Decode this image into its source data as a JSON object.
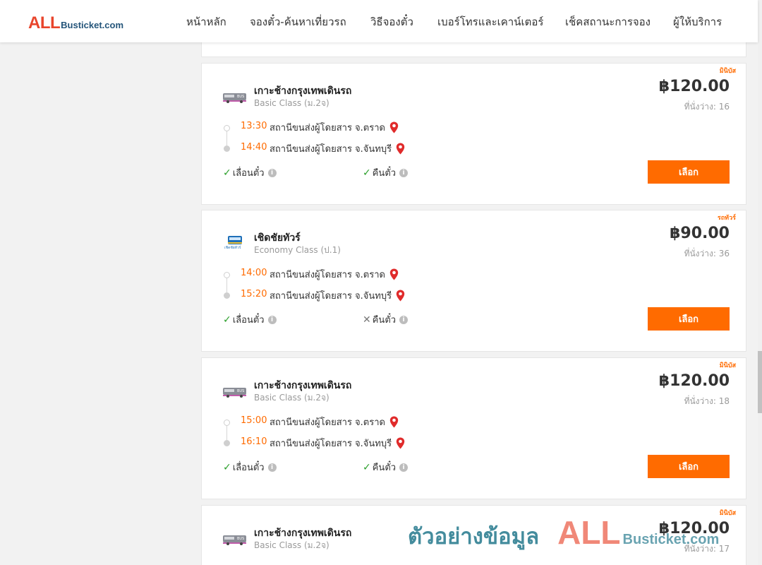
{
  "brand": {
    "logo_all": "ALL",
    "logo_rest": "Busticket.com"
  },
  "nav": {
    "items": [
      {
        "label": "หน้าหลัก"
      },
      {
        "label": "จองตั๋ว-ค้นหาเที่ยวรถ"
      },
      {
        "label": "วิธีจองตั๋ว"
      },
      {
        "label": "เบอร์โทรและเคาน์เตอร์"
      },
      {
        "label": "เช็คสถานะการจอง"
      },
      {
        "label": "ผู้ให้บริการ"
      }
    ]
  },
  "trips": [
    {
      "type_tag": "มินิบัส",
      "operator": "เกาะช้างกรุงเทพเดินรถ",
      "class": "Basic Class (ม.2จ)",
      "price": "฿120.00",
      "seats": "ที่นั่งว่าง: 16",
      "depart_time": "13:30",
      "depart_station": "สถานีขนส่งผู้โดยสาร จ.ตราด",
      "arrive_time": "14:40",
      "arrive_station": "สถานีขนส่งผู้โดยสาร จ.จันทบุรี",
      "option_change": "เลื่อนตั๋ว",
      "option_change_available": true,
      "option_refund": "คืนตั๋ว",
      "option_refund_available": true,
      "select_label": "เลือก",
      "logo_icon": "bus-company-logo-icon"
    },
    {
      "type_tag": "รถทัวร์",
      "operator": "เชิดชัยทัวร์",
      "class": "Economy Class (ป.1)",
      "price": "฿90.00",
      "seats": "ที่นั่งว่าง: 36",
      "depart_time": "14:00",
      "depart_station": "สถานีขนส่งผู้โดยสาร จ.ตราด",
      "arrive_time": "15:20",
      "arrive_station": "สถานีขนส่งผู้โดยสาร จ.จันทบุรี",
      "option_change": "เลื่อนตั๋ว",
      "option_change_available": true,
      "option_refund": "คืนตั๋ว",
      "option_refund_available": false,
      "select_label": "เลือก",
      "logo_icon": "cherdchai-tour-logo-icon"
    },
    {
      "type_tag": "มินิบัส",
      "operator": "เกาะช้างกรุงเทพเดินรถ",
      "class": "Basic Class (ม.2จ)",
      "price": "฿120.00",
      "seats": "ที่นั่งว่าง: 18",
      "depart_time": "15:00",
      "depart_station": "สถานีขนส่งผู้โดยสาร จ.ตราด",
      "arrive_time": "16:10",
      "arrive_station": "สถานีขนส่งผู้โดยสาร จ.จันทบุรี",
      "option_change": "เลื่อนตั๋ว",
      "option_change_available": true,
      "option_refund": "คืนตั๋ว",
      "option_refund_available": true,
      "select_label": "เลือก",
      "logo_icon": "bus-company-logo-icon"
    },
    {
      "type_tag": "มินิบัส",
      "operator": "เกาะช้างกรุงเทพเดินรถ",
      "class": "Basic Class (ม.2จ)",
      "price": "฿120.00",
      "seats": "ที่นั่งว่าง: 17",
      "logo_icon": "bus-company-logo-icon"
    }
  ],
  "watermark": {
    "thai": "ตัวอย่างข้อมูล",
    "all": "ALL",
    "rest": "Busticket.com"
  },
  "colors": {
    "accent": "#ff6b00",
    "brand_red": "#e8452c",
    "brand_blue": "#24557a",
    "check_green": "#2ca02c"
  }
}
